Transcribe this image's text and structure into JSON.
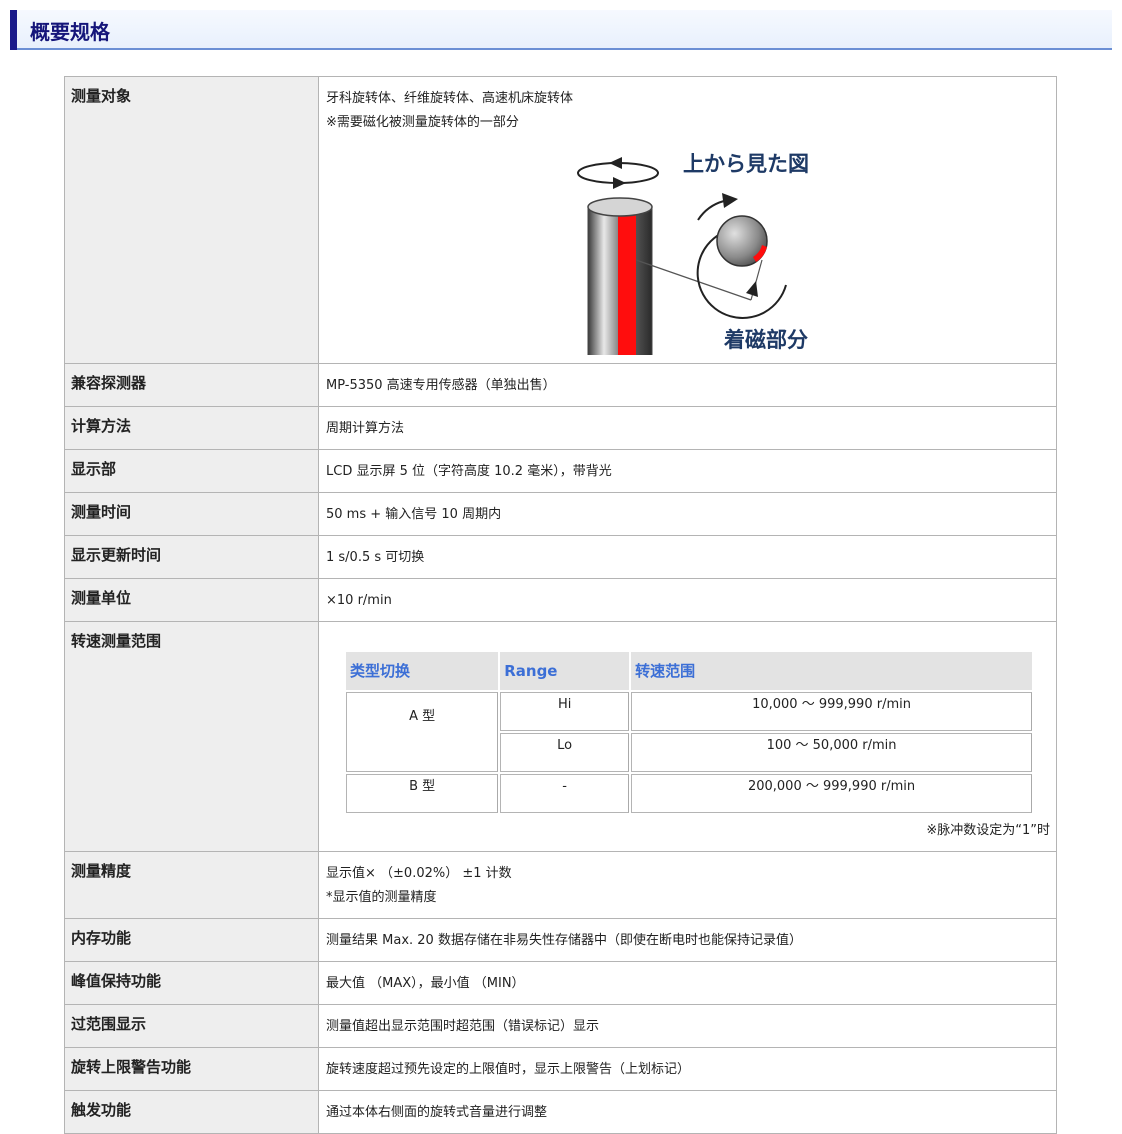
{
  "section_title": "概要规格",
  "rows": [
    {
      "label": "测量对象",
      "lines": [
        "牙科旋转体、纤维旋转体、高速机床旋转体",
        "※需要磁化被测量旋转体的一部分"
      ]
    },
    {
      "label": "兼容探测器",
      "lines": [
        "MP-5350 高速专用传感器（单独出售）"
      ]
    },
    {
      "label": "计算方法",
      "lines": [
        "周期计算方法"
      ]
    },
    {
      "label": "显示部",
      "lines": [
        "LCD 显示屏 5 位（字符高度 10.2 毫米），带背光"
      ]
    },
    {
      "label": "测量时间",
      "lines": [
        "50 ms + 输入信号 10 周期内"
      ]
    },
    {
      "label": "显示更新时间",
      "lines": [
        "1 s/0.5 s 可切换"
      ]
    },
    {
      "label": "测量单位",
      "lines": [
        "×10 r/min"
      ]
    },
    {
      "label": "转速测量范围",
      "lines": []
    },
    {
      "label": "测量精度",
      "lines": [
        "显示值× （±0.02%） ±1 计数",
        "*显示值的测量精度"
      ]
    },
    {
      "label": "内存功能",
      "lines": [
        "测量结果 Max. 20 数据存储在非易失性存储器中（即使在断电时也能保持记录值）"
      ]
    },
    {
      "label": "峰值保持功能",
      "lines": [
        "最大值 （MAX），最小值 （MIN）"
      ]
    },
    {
      "label": "过范围显示",
      "lines": [
        "测量值超出显示范围时超范围（错误标记）显示"
      ]
    },
    {
      "label": "旋转上限警告功能",
      "lines": [
        "旋转速度超过预先设定的上限值时，显示上限警告（上划标记）"
      ]
    },
    {
      "label": "触发功能",
      "lines": [
        "通过本体右侧面的旋转式音量进行调整"
      ]
    }
  ],
  "illustration": {
    "top_view_label": "上から見た図",
    "magnet_label": "着磁部分"
  },
  "range_table": {
    "headers": [
      "类型切换",
      "Range",
      "转速范围"
    ],
    "type_a": "A 型",
    "type_b": "B 型",
    "rows": [
      {
        "range": "Hi",
        "speed": "10,000 ～ 999,990 r/min"
      },
      {
        "range": "Lo",
        "speed": "100 ～ 50,000 r/min"
      },
      {
        "range": "-",
        "speed": "200,000 ～ 999,990 r/min"
      }
    ],
    "note": "※脉冲数设定为“1”时"
  }
}
